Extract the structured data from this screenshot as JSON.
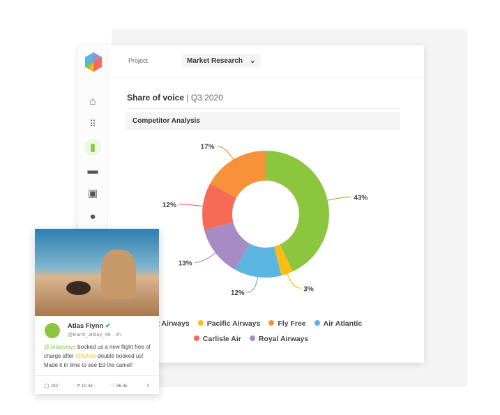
{
  "header": {
    "project_label": "Project",
    "project_value": "Market Research"
  },
  "sidebar": {
    "items": [
      "home-icon",
      "apps-icon",
      "chart-icon",
      "briefcase-icon",
      "report-icon",
      "alert-icon"
    ],
    "active": "chart-icon"
  },
  "main": {
    "title": "Share of voice",
    "period": "Q3 2020",
    "section": "Competitor Analysis"
  },
  "chart_data": {
    "type": "pie",
    "donut": true,
    "categories": [
      "Jet Airways",
      "Pacific Airways",
      "Air Atlantic",
      "Royal Airways",
      "Carlisle Air",
      "Fly Free"
    ],
    "values": [
      43,
      3,
      12,
      13,
      12,
      17
    ],
    "labels": [
      "43%",
      "3%",
      "12%",
      "13%",
      "12%",
      "17%"
    ],
    "colors": [
      "#8cc63f",
      "#fbbd12",
      "#5bb5e0",
      "#a78bc4",
      "#f76a55",
      "#f7923a"
    ],
    "legend": [
      {
        "name": "Jet Airways",
        "color": "#8cc63f"
      },
      {
        "name": "Pacific Airways",
        "color": "#fbbd12"
      },
      {
        "name": "Fly Free",
        "color": "#f7923a"
      },
      {
        "name": "Air Atlantic",
        "color": "#5bb5e0"
      },
      {
        "name": "Carlisle Air",
        "color": "#f76a55"
      },
      {
        "name": "Royal Airways",
        "color": "#a78bc4"
      }
    ],
    "legend_position": "bottom"
  },
  "tweet": {
    "name": "Atlas Flynn",
    "handle": "@Earth_allday_98",
    "time": "2h",
    "mention1": "@Jetairways",
    "text1": " booked us a new flight free of charge after ",
    "mention2": "@flyfree",
    "text2": " double booked us! Made it in time to see Ed the camel!",
    "replies": "192",
    "retweets": "10.3k",
    "likes": "86.4k"
  }
}
